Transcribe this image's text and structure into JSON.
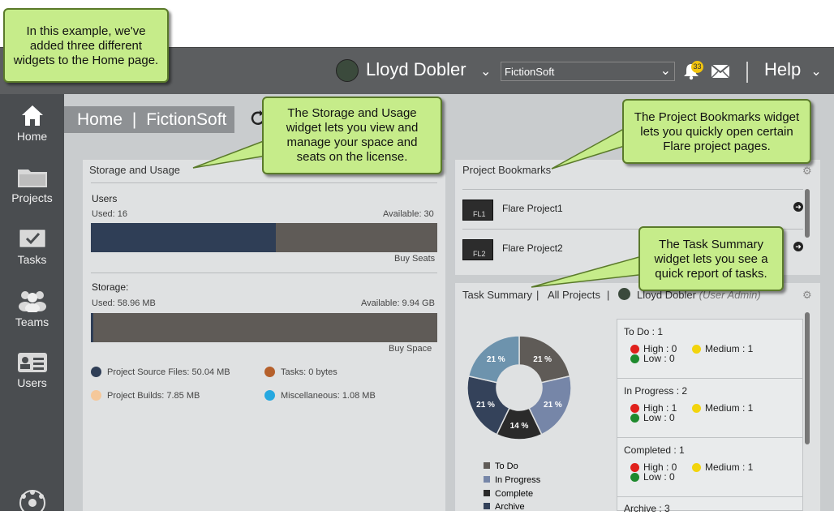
{
  "callouts": {
    "intro": [
      "In this example, we've",
      "added three different",
      "widgets to the Home page."
    ],
    "storage": [
      "The Storage and Usage",
      "widget lets you view and",
      "manage your space and",
      "seats on the license."
    ],
    "bookmarks": [
      "The Project Bookmarks widget",
      "lets you quickly open certain",
      "Flare project pages."
    ],
    "tasks": [
      "The Task Summary",
      "widget lets you see a",
      "quick report of tasks."
    ]
  },
  "header": {
    "user_name": "Lloyd Dobler",
    "license_select": "FictionSoft",
    "notification_count": "33",
    "help_label": "Help"
  },
  "sidebar": {
    "items": [
      {
        "label": "Home"
      },
      {
        "label": "Projects"
      },
      {
        "label": "Tasks"
      },
      {
        "label": "Teams"
      },
      {
        "label": "Users"
      }
    ]
  },
  "page": {
    "breadcrumb_home": "Home",
    "breadcrumb_sep": "|",
    "breadcrumb_license": "FictionSoft"
  },
  "storage": {
    "title": "Storage and Usage",
    "users_label": "Users",
    "users_used": "Used: 16",
    "users_available": "Available: 30",
    "users_used_fraction": 0.533,
    "buy_seats": "Buy Seats",
    "storage_label": "Storage:",
    "storage_used": "Used: 58.96 MB",
    "storage_available": "Available: 9.94 GB",
    "storage_used_fraction": 0.006,
    "buy_space": "Buy Space",
    "legend": [
      {
        "label": "Project Source Files: 50.04 MB",
        "color": "#2f3e56"
      },
      {
        "label": "Tasks: 0 bytes",
        "color": "#b5602b"
      },
      {
        "label": "Project Builds: 7.85 MB",
        "color": "#f5c89a"
      },
      {
        "label": "Miscellaneous: 1.08 MB",
        "color": "#26a8e0"
      }
    ]
  },
  "bookmarks": {
    "title": "Project Bookmarks",
    "items": [
      {
        "badge": "FL1",
        "name": "Flare Project1"
      },
      {
        "badge": "FL2",
        "name": "Flare Project2"
      }
    ]
  },
  "task_summary": {
    "title": "Task Summary",
    "sep": "|",
    "filter": "All Projects",
    "user": "Lloyd Dobler",
    "role": "(User Admin)",
    "legend": [
      "To Do",
      "In Progress",
      "Complete",
      "Archive"
    ],
    "blocks": [
      {
        "heading": "To Do : 1",
        "high": "High : 0",
        "medium": "Medium : 1",
        "low": "Low : 0"
      },
      {
        "heading": "In Progress : 2",
        "high": "High : 1",
        "medium": "Medium : 1",
        "low": "Low : 0"
      },
      {
        "heading": "Completed : 1",
        "high": "High : 0",
        "medium": "Medium : 1",
        "low": "Low : 0"
      },
      {
        "heading": "Archive : 3"
      }
    ],
    "colors": {
      "high": "#e0201b",
      "medium": "#f2d40d",
      "low": "#1e8a2d"
    }
  },
  "chart_data": {
    "type": "pie",
    "slices": [
      {
        "value": 21,
        "label": "21 %",
        "color": "#5f5b57"
      },
      {
        "value": 21,
        "label": "21 %",
        "color": "#7686a8"
      },
      {
        "value": 14,
        "label": "14 %",
        "color": "#2a2a2a"
      },
      {
        "value": 21,
        "label": "21 %",
        "color": "#34425a"
      },
      {
        "value": 21,
        "label": "21 %",
        "color": "#6d93ad"
      }
    ]
  }
}
